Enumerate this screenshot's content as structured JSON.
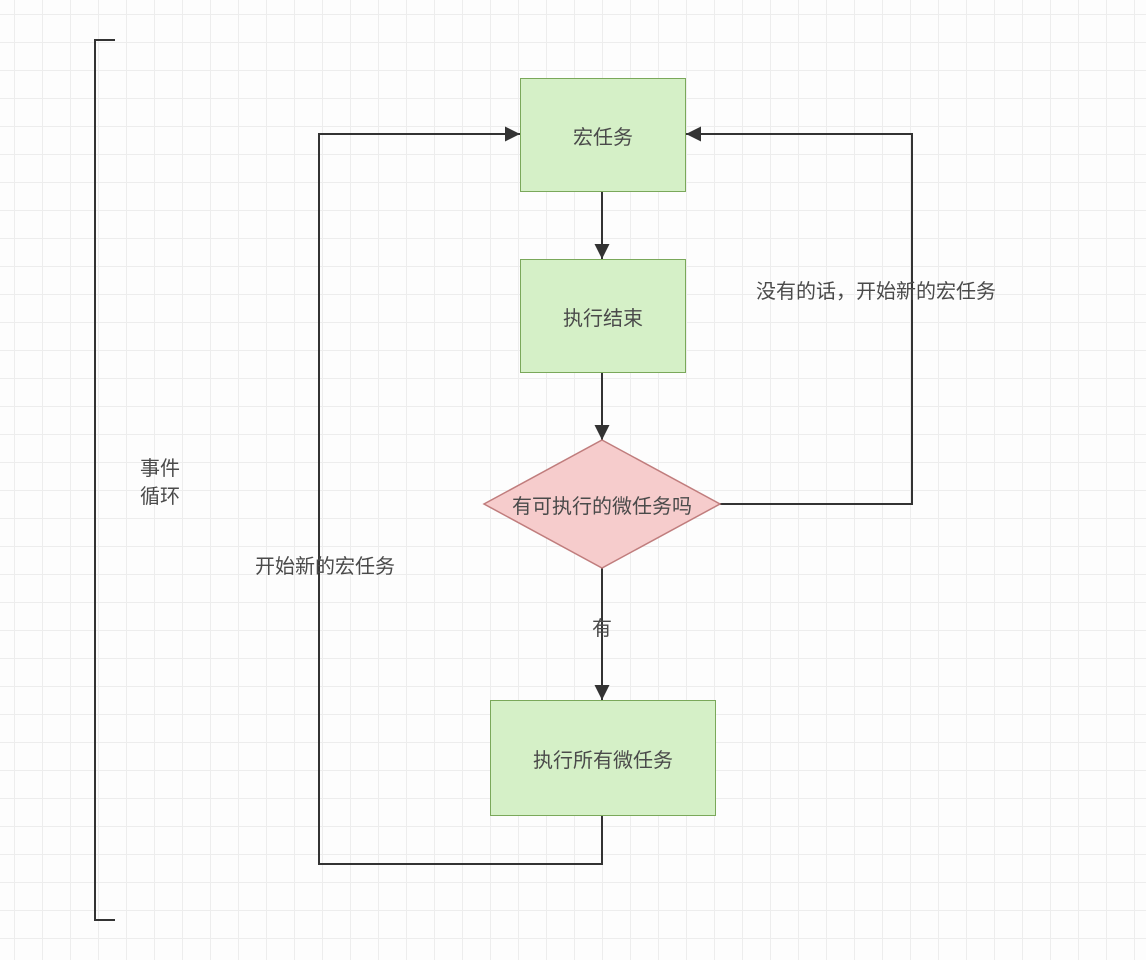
{
  "nodes": {
    "macrotask": {
      "label": "宏任务"
    },
    "execdone": {
      "label": "执行结束"
    },
    "hasmicro": {
      "label": "有可执行的微任务吗"
    },
    "runmicro": {
      "label": "执行所有微任务"
    }
  },
  "edges": {
    "hasmicro_yes": {
      "label": "有"
    },
    "no_new_macro": {
      "label": "没有的话，开始新的宏任务"
    },
    "loopback": {
      "label": "开始新的宏任务"
    }
  },
  "bracket": {
    "line1": "事件",
    "line2": "循环"
  }
}
